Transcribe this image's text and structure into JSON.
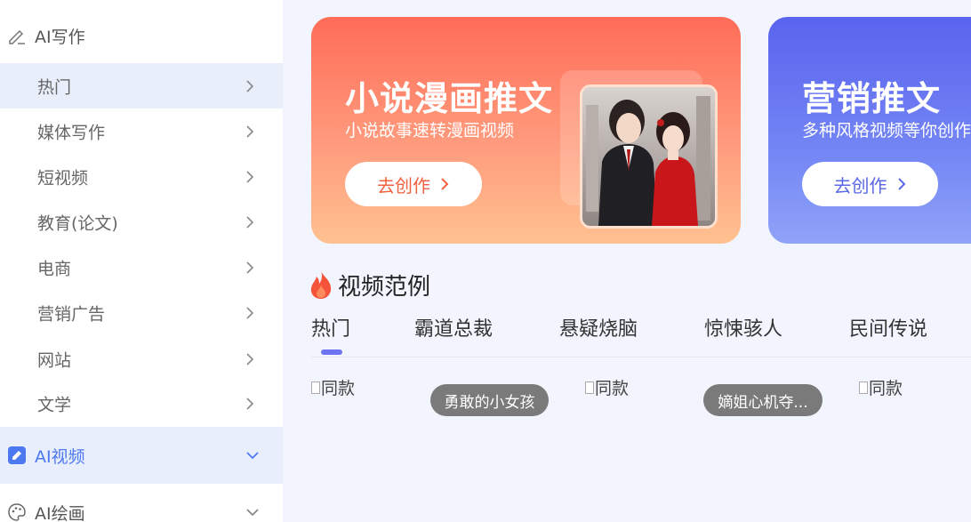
{
  "sidebar": {
    "writing_label": "AI写作",
    "items": [
      {
        "label": "热门"
      },
      {
        "label": "媒体写作"
      },
      {
        "label": "短视频"
      },
      {
        "label": "教育(论文)"
      },
      {
        "label": "电商"
      },
      {
        "label": "营销广告"
      },
      {
        "label": "网站"
      },
      {
        "label": "文学"
      }
    ],
    "video_label": "AI视频",
    "draw_label": "AI绘画"
  },
  "banners": [
    {
      "title": "小说漫画推文",
      "subtitle": "小说故事速转漫画视频",
      "button": "去创作"
    },
    {
      "title": "营销推文",
      "subtitle": "多种风格视频等你创作",
      "button": "去创作"
    }
  ],
  "examples": {
    "title": "视频范例",
    "tabs": [
      "热门",
      "霸道总裁",
      "悬疑烧脑",
      "惊悚骇人",
      "民间传说"
    ],
    "cards": [
      {
        "image_alt": "同款",
        "tag": "勇敢的小女孩"
      },
      {
        "image_alt": "同款",
        "tag": "嫡姐心机夺..."
      },
      {
        "image_alt": "同款"
      }
    ]
  },
  "colors": {
    "accent": "#4d79f0",
    "tab_indicator": "#6c74f2",
    "banner1_button_text": "#f2603f",
    "banner2_button_text": "#5a67e6"
  }
}
